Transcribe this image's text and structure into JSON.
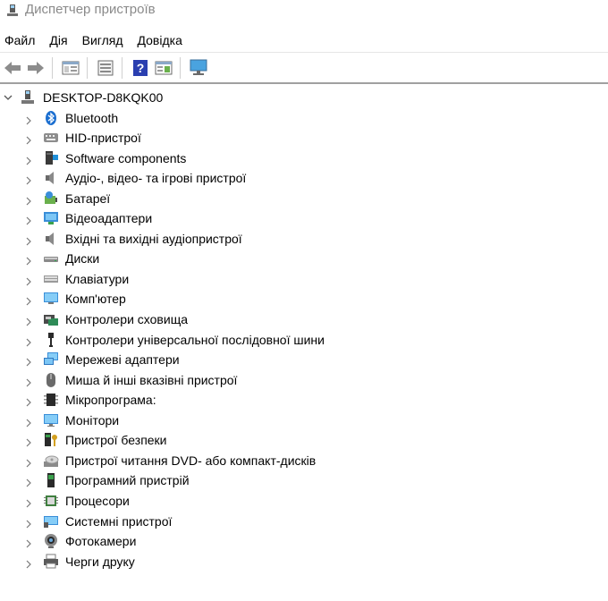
{
  "window": {
    "title": "Диспетчер пристроїв"
  },
  "menu": [
    {
      "label": "Файл"
    },
    {
      "label": "Дія"
    },
    {
      "label": "Вигляд"
    },
    {
      "label": "Довідка"
    }
  ],
  "toolbar": {
    "buttons": [
      "back-arrow-icon",
      "forward-arrow-icon",
      "show-hide-tree-icon",
      "properties-icon",
      "help-icon",
      "action-pane-icon",
      "monitor-scan-icon"
    ]
  },
  "tree": {
    "root": "DESKTOP-D8KQK00",
    "categories": [
      {
        "label": "Bluetooth",
        "icon": "bluetooth-icon"
      },
      {
        "label": "HID-пристрої",
        "icon": "hid-icon"
      },
      {
        "label": "Software components",
        "icon": "software-components-icon"
      },
      {
        "label": "Аудіо-, відео- та ігрові пристрої",
        "icon": "speaker-icon"
      },
      {
        "label": "Батареї",
        "icon": "battery-icon"
      },
      {
        "label": "Відеоадаптери",
        "icon": "display-adapter-icon"
      },
      {
        "label": "Вхідні та вихідні аудіопристрої",
        "icon": "speaker-icon"
      },
      {
        "label": "Диски",
        "icon": "disk-icon"
      },
      {
        "label": "Клавіатури",
        "icon": "keyboard-icon"
      },
      {
        "label": "Комп'ютер",
        "icon": "computer-icon"
      },
      {
        "label": "Контролери сховища",
        "icon": "storage-controller-icon"
      },
      {
        "label": "Контролери універсальної послідовної шини",
        "icon": "usb-icon"
      },
      {
        "label": "Мережеві адаптери",
        "icon": "network-adapter-icon"
      },
      {
        "label": "Миша й інші вказівні пристрої",
        "icon": "mouse-icon"
      },
      {
        "label": "Мікропрограма:",
        "icon": "firmware-chip-icon"
      },
      {
        "label": "Монітори",
        "icon": "monitor-icon"
      },
      {
        "label": "Пристрої безпеки",
        "icon": "security-key-icon"
      },
      {
        "label": "Пристрої читання DVD- або компакт-дисків",
        "icon": "dvd-drive-icon"
      },
      {
        "label": "Програмний пристрій",
        "icon": "software-device-icon"
      },
      {
        "label": "Процесори",
        "icon": "processor-icon"
      },
      {
        "label": "Системні пристрої",
        "icon": "system-devices-icon"
      },
      {
        "label": "Фотокамери",
        "icon": "camera-icon"
      },
      {
        "label": "Черги друку",
        "icon": "printer-icon"
      }
    ]
  }
}
